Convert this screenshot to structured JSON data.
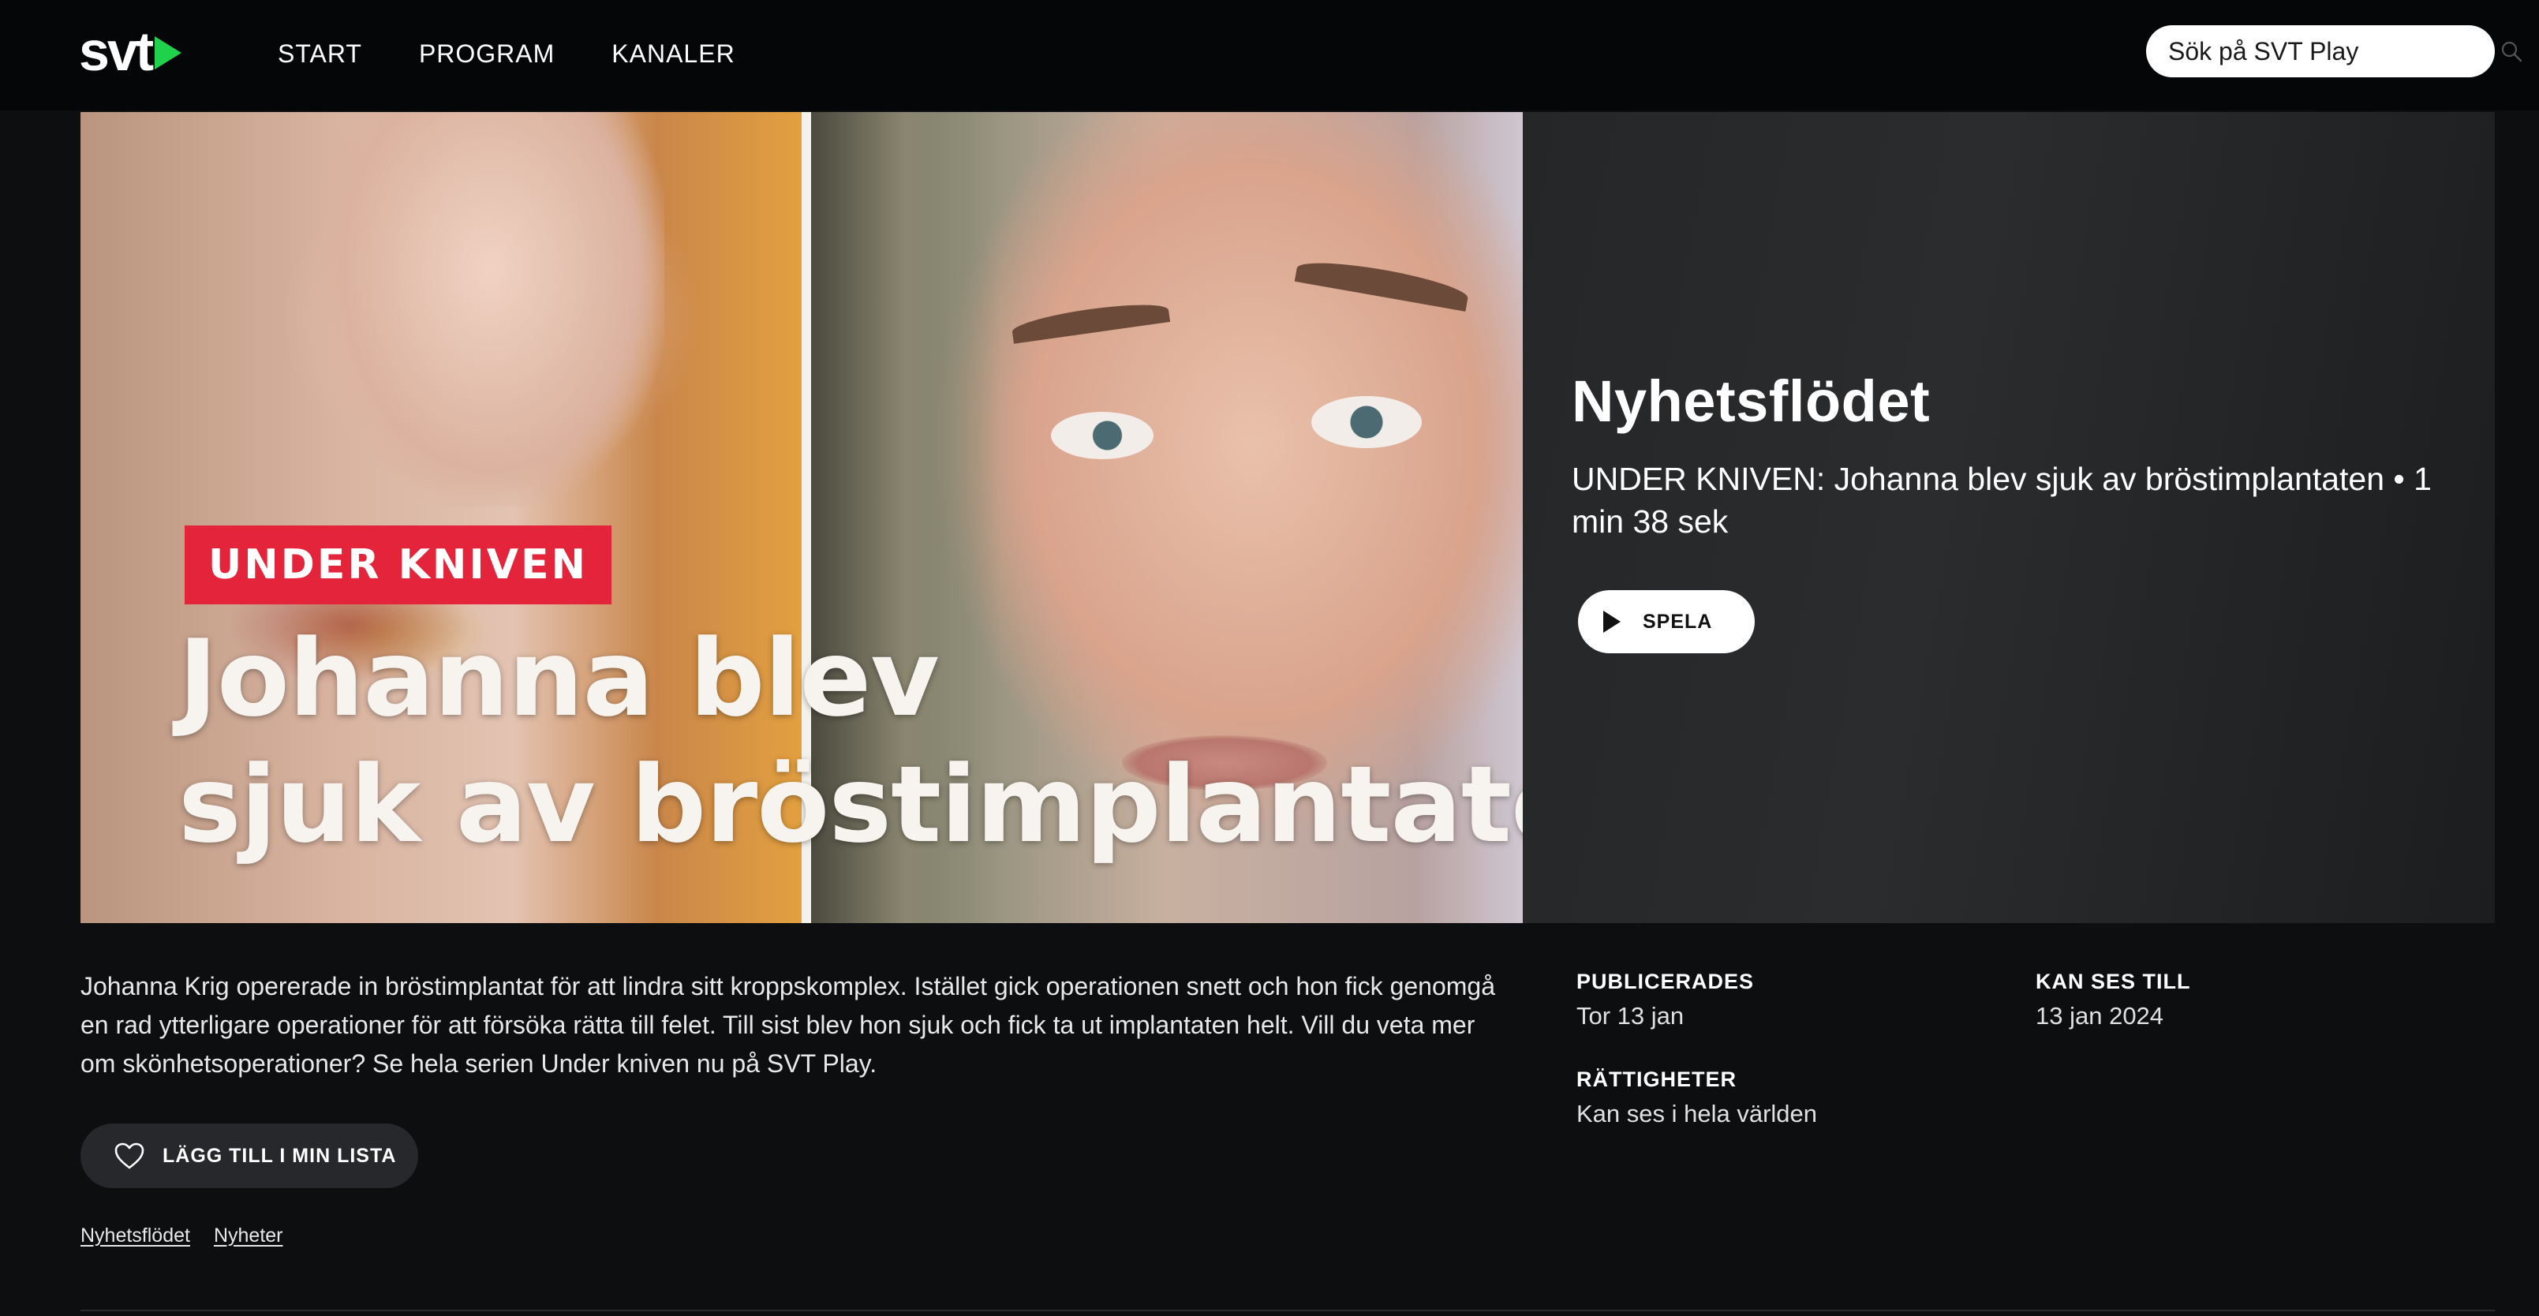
{
  "header": {
    "logo_text": "svt",
    "nav": [
      {
        "label": "START"
      },
      {
        "label": "PROGRAM"
      },
      {
        "label": "KANALER"
      }
    ],
    "search": {
      "placeholder": "Sök på SVT Play",
      "icon": "search-icon"
    }
  },
  "hero": {
    "image": {
      "tag": "UNDER KNIVEN",
      "headline_line1": "Johanna blev",
      "headline_line2": "sjuk av bröstimplantaten"
    },
    "title": "Nyhetsflödet",
    "subtitle": "UNDER KNIVEN: Johanna blev sjuk av bröstimplantaten • 1 min 38 sek",
    "play_label": "SPELA"
  },
  "details": {
    "description": "Johanna Krig opererade in bröstimplantat för att lindra sitt kroppskomplex. Istället gick operationen snett och hon fick genomgå en rad ytterligare operationer för att försöka rätta till felet. Till sist blev hon sjuk och fick ta ut implantaten helt. Vill du veta mer om skönhetsoperationer? Se hela serien Under kniven nu på SVT Play.",
    "mylist_label": "LÄGG TILL I MIN LISTA",
    "tags": [
      "Nyhetsflödet",
      "Nyheter"
    ],
    "meta": {
      "published_label": "PUBLICERADES",
      "published_value": "Tor 13 jan",
      "available_label": "KAN SES TILL",
      "available_value": "13 jan 2024",
      "rights_label": "RÄTTIGHETER",
      "rights_value": "Kan ses i hela världen"
    }
  },
  "colors": {
    "background": "#0d0e10",
    "header": "#050607",
    "brand_green": "#1fd14b",
    "tag_red": "#e4243a",
    "button_dark": "#26282b"
  }
}
